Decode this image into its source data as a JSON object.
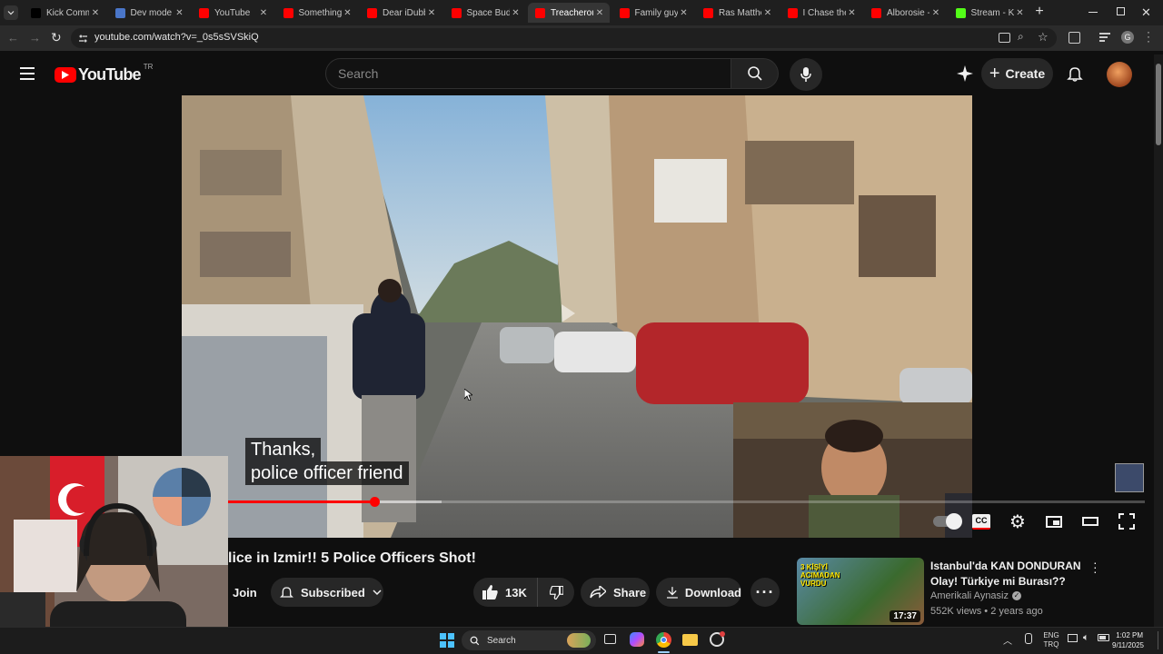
{
  "browser": {
    "tabs": [
      {
        "label": "Kick Commu",
        "color": "#000000"
      },
      {
        "label": "Dev mode |",
        "color": "#4a76c9"
      },
      {
        "label": "YouTube",
        "color": "#ff0000"
      },
      {
        "label": "Something i",
        "color": "#ff0000"
      },
      {
        "label": "Dear iDubbl",
        "color": "#ff0000"
      },
      {
        "label": "Space Buddi",
        "color": "#ff0000"
      },
      {
        "label": "Treacherous",
        "color": "#ff0000"
      },
      {
        "label": "Family guy -",
        "color": "#ff0000"
      },
      {
        "label": "Ras Matthew",
        "color": "#ff0000"
      },
      {
        "label": "I Chase the",
        "color": "#ff0000"
      },
      {
        "label": "Alborosie -",
        "color": "#ff0000"
      },
      {
        "label": "Stream - Kic",
        "color": "#53fc18"
      }
    ],
    "active_tab": 6,
    "url": "youtube.com/watch?v=_0s5sSVSkiQ",
    "profile_initial": "G"
  },
  "youtube": {
    "logo_text": "YouTube",
    "region": "TR",
    "search_placeholder": "Search",
    "create_label": "Create"
  },
  "video": {
    "subtitle_line1": "Thanks,",
    "subtitle_line2": "police officer friend",
    "progress": 0.2,
    "buffered": 0.27,
    "title": "lice in Izmir!! 5 Police Officers Shot!",
    "join_label": "Join",
    "subscribed_label": "Subscribed",
    "likes": "13K",
    "share_label": "Share",
    "download_label": "Download"
  },
  "recommendation": {
    "title_line1": "Istanbul'da KAN DONDURAN",
    "title_line2": "Olay! Türkiye mi Burası??",
    "channel": "Amerikali Aynasiz",
    "meta": "552K views • 2 years ago",
    "duration": "17:37",
    "thumb_text": "3 KİŞİYİ ACIMADAN VURDU"
  },
  "taskbar": {
    "search_label": "Search",
    "lang_line1": "ENG",
    "lang_line2": "TRQ",
    "time": "1:02 PM",
    "date": "9/11/2025"
  },
  "colors": {
    "yt_red": "#ff0000",
    "accent": "#ff4e45"
  }
}
